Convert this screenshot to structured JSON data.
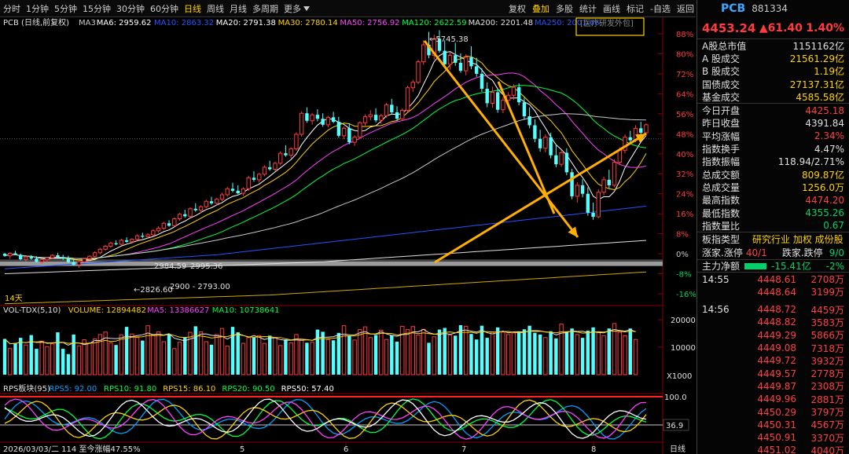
{
  "toolbar": {
    "left_items": [
      "分时",
      "1分钟",
      "5分钟",
      "15分钟",
      "30分钟",
      "60分钟",
      "日线",
      "周线",
      "月线",
      "多周期",
      "更多"
    ],
    "active": "日线",
    "right_items": [
      "复权",
      "叠加",
      "多股",
      "统计",
      "画线",
      "标记",
      "-自选",
      "返回"
    ],
    "highlight": "叠加"
  },
  "main_legend": {
    "title": "PCB (日线,前复权)",
    "items": [
      {
        "label": "MA3",
        "color": "#c8c8c8"
      },
      {
        "label": "MA6: 2959.62",
        "color": "#ffffff"
      },
      {
        "label": "MA10: 2863.32",
        "color": "#2255ff"
      },
      {
        "label": "MA20: 2791.38",
        "color": "#ffffff"
      },
      {
        "label": "MA30: 2780.14",
        "color": "#ffd200"
      },
      {
        "label": "MA50: 2756.92",
        "color": "#ff40ff"
      },
      {
        "label": "MA120: 2622.59",
        "color": "#00ff40"
      },
      {
        "label": "MA200: 2201.48",
        "color": "#e0e0e0"
      },
      {
        "label": "MA250: 2001.66",
        "color": "#2255ff"
      }
    ],
    "badge": "[医疗研发外包]",
    "badge_color": "#ffd200"
  },
  "volume_legend": {
    "items": [
      {
        "label": "VOL-TDX(5,10)",
        "color": "#e0e0e0"
      },
      {
        "label": "VOLUME: 12894482",
        "color": "#ffd200"
      },
      {
        "label": "MA5: 13386627",
        "color": "#ff40ff"
      },
      {
        "label": "MA10: 10738641",
        "color": "#00ff40"
      }
    ]
  },
  "rps_legend": {
    "items": [
      {
        "label": "RPS板块(95)",
        "color": "#e0e0e0"
      },
      {
        "label": "RPS5: 92.00",
        "color": "#00a0ff"
      },
      {
        "label": "RPS10: 91.80",
        "color": "#00ff40"
      },
      {
        "label": "RPS15: 86.10",
        "color": "#ffd200"
      },
      {
        "label": "RPS20: 90.50",
        "color": "#00ff40"
      },
      {
        "label": "RPS50: 57.40",
        "color": "#ffffff"
      }
    ]
  },
  "annotations": {
    "high_label": "5745.38",
    "low_label": "2826.60",
    "label_a": "2984.59",
    "label_b": "2995.36",
    "label_c": "2900 - 2793.00",
    "days_label": "14天",
    "scale_label": "X1000",
    "rps_current": "36.9",
    "bottom_info": "2026/03/03/二 114 至今涨幅47.55%",
    "period_label": "日线"
  },
  "chart_data": {
    "type": "candlestick",
    "x_month_labels": [
      "5",
      "6",
      "7",
      "8"
    ],
    "y_pct_ticks": [
      "88%",
      "80%",
      "72%",
      "64%",
      "56%",
      "48%",
      "40%",
      "32%",
      "24%",
      "16%",
      "8%",
      "0%",
      "-8%",
      "-16%"
    ],
    "volume_ticks": [
      "20000",
      "10000"
    ],
    "rps_ticks": [
      "100.0"
    ],
    "candles": [
      [
        0.0,
        0.4,
        -1.2,
        -0.8
      ],
      [
        -0.8,
        0.6,
        -2.0,
        0.2
      ],
      [
        0.2,
        1.2,
        -0.5,
        -0.4
      ],
      [
        -0.4,
        0.1,
        -2.6,
        -2.2
      ],
      [
        -2.2,
        -0.9,
        -3.0,
        -1.3
      ],
      [
        -1.3,
        -0.5,
        -2.4,
        -1.9
      ],
      [
        -1.9,
        -1.0,
        -3.6,
        -3.2
      ],
      [
        -3.2,
        -1.8,
        -4.0,
        -2.4
      ],
      [
        -2.4,
        -1.2,
        -3.4,
        -1.6
      ],
      [
        -1.6,
        -0.2,
        -2.2,
        -0.6
      ],
      [
        -0.6,
        0.4,
        -1.8,
        -1.4
      ],
      [
        -1.4,
        -0.4,
        -2.6,
        -2.0
      ],
      [
        -2.0,
        -0.8,
        -3.8,
        -3.4
      ],
      [
        -3.4,
        -2.2,
        -4.8,
        -4.4
      ],
      [
        -4.4,
        -2.8,
        -5.6,
        -3.2
      ],
      [
        -3.2,
        -1.6,
        -3.8,
        -2.0
      ],
      [
        -2.0,
        -0.6,
        -2.6,
        -1.0
      ],
      [
        -1.0,
        1.0,
        -1.4,
        0.4
      ],
      [
        0.4,
        2.4,
        -0.2,
        1.8
      ],
      [
        1.8,
        3.6,
        1.2,
        3.0
      ],
      [
        3.0,
        4.8,
        2.4,
        4.2
      ],
      [
        4.2,
        5.4,
        3.4,
        3.8
      ],
      [
        3.8,
        6.0,
        3.2,
        5.4
      ],
      [
        5.4,
        6.6,
        4.4,
        4.8
      ],
      [
        4.8,
        6.2,
        4.0,
        5.8
      ],
      [
        5.8,
        7.8,
        5.2,
        7.2
      ],
      [
        7.2,
        8.4,
        6.2,
        6.8
      ],
      [
        6.8,
        8.2,
        6.0,
        7.6
      ],
      [
        7.6,
        9.8,
        7.0,
        9.2
      ],
      [
        9.2,
        11.0,
        8.4,
        10.2
      ],
      [
        10.2,
        12.8,
        9.6,
        12.2
      ],
      [
        12.2,
        13.4,
        10.8,
        11.2
      ],
      [
        11.2,
        14.6,
        10.6,
        14.0
      ],
      [
        14.0,
        16.4,
        13.2,
        15.8
      ],
      [
        15.8,
        17.6,
        14.4,
        15.0
      ],
      [
        15.0,
        18.6,
        14.4,
        18.0
      ],
      [
        18.0,
        20.2,
        16.8,
        17.4
      ],
      [
        17.4,
        19.4,
        16.2,
        18.8
      ],
      [
        18.8,
        21.6,
        18.2,
        21.0
      ],
      [
        21.0,
        22.8,
        19.6,
        20.2
      ],
      [
        20.2,
        22.4,
        19.4,
        21.8
      ],
      [
        21.8,
        24.4,
        21.0,
        23.6
      ],
      [
        23.6,
        26.8,
        22.8,
        26.0
      ],
      [
        26.0,
        28.4,
        24.6,
        25.2
      ],
      [
        25.2,
        27.4,
        23.8,
        24.2
      ],
      [
        24.2,
        26.6,
        23.2,
        26.0
      ],
      [
        26.0,
        31.2,
        25.2,
        30.4
      ],
      [
        30.4,
        33.0,
        28.8,
        29.6
      ],
      [
        29.6,
        32.4,
        28.4,
        31.8
      ],
      [
        31.8,
        35.4,
        31.0,
        34.6
      ],
      [
        34.6,
        37.2,
        33.2,
        33.8
      ],
      [
        33.8,
        36.8,
        33.0,
        36.2
      ],
      [
        36.2,
        41.0,
        35.4,
        40.2
      ],
      [
        40.2,
        43.4,
        38.8,
        39.4
      ],
      [
        39.4,
        42.6,
        38.2,
        42.0
      ],
      [
        42.0,
        48.6,
        41.2,
        47.8
      ],
      [
        47.8,
        57.0,
        46.8,
        56.2
      ],
      [
        56.2,
        58.6,
        52.4,
        53.2
      ],
      [
        53.2,
        56.4,
        51.6,
        55.6
      ],
      [
        55.6,
        57.8,
        53.0,
        54.0
      ],
      [
        54.0,
        56.2,
        50.8,
        51.6
      ],
      [
        51.6,
        55.2,
        50.6,
        54.6
      ],
      [
        54.6,
        56.8,
        52.2,
        52.8
      ],
      [
        52.8,
        54.8,
        46.4,
        47.2
      ],
      [
        47.2,
        51.0,
        45.8,
        50.2
      ],
      [
        50.2,
        52.2,
        43.8,
        44.6
      ],
      [
        44.6,
        47.4,
        43.2,
        46.6
      ],
      [
        46.6,
        53.0,
        46.0,
        52.4
      ],
      [
        52.4,
        55.8,
        51.2,
        54.8
      ],
      [
        54.8,
        57.4,
        53.4,
        55.6
      ],
      [
        55.6,
        58.2,
        52.6,
        53.4
      ],
      [
        53.4,
        56.0,
        52.0,
        55.2
      ],
      [
        55.2,
        60.4,
        54.4,
        59.6
      ],
      [
        59.6,
        62.0,
        55.8,
        56.6
      ],
      [
        56.6,
        59.0,
        53.2,
        54.0
      ],
      [
        54.0,
        58.2,
        53.2,
        57.4
      ],
      [
        57.4,
        67.2,
        56.6,
        66.4
      ],
      [
        66.4,
        69.6,
        64.8,
        68.6
      ],
      [
        68.6,
        77.6,
        67.8,
        76.8
      ],
      [
        76.8,
        85.4,
        75.6,
        83.6
      ],
      [
        83.6,
        88.8,
        78.2,
        79.4
      ],
      [
        79.4,
        87.6,
        77.6,
        86.0
      ],
      [
        86.0,
        89.4,
        80.4,
        81.2
      ],
      [
        81.2,
        85.4,
        74.6,
        75.8
      ],
      [
        75.8,
        80.6,
        73.6,
        79.4
      ],
      [
        79.4,
        84.4,
        75.2,
        76.4
      ],
      [
        76.4,
        80.2,
        72.4,
        73.2
      ],
      [
        73.2,
        79.8,
        71.4,
        78.6
      ],
      [
        78.6,
        83.0,
        73.8,
        75.0
      ],
      [
        75.0,
        78.4,
        70.8,
        72.0
      ],
      [
        72.0,
        74.2,
        64.8,
        66.0
      ],
      [
        66.0,
        68.6,
        58.6,
        60.2
      ],
      [
        60.2,
        66.8,
        58.4,
        64.6
      ],
      [
        64.6,
        65.8,
        56.4,
        57.6
      ],
      [
        57.6,
        62.8,
        56.2,
        61.4
      ],
      [
        61.4,
        64.6,
        59.2,
        63.4
      ],
      [
        63.4,
        67.8,
        61.6,
        66.6
      ],
      [
        66.6,
        68.2,
        59.4,
        60.6
      ],
      [
        60.6,
        62.4,
        53.6,
        55.0
      ],
      [
        55.0,
        58.6,
        50.2,
        51.4
      ],
      [
        51.4,
        53.8,
        44.6,
        46.0
      ],
      [
        46.0,
        49.6,
        40.8,
        42.2
      ],
      [
        42.2,
        47.8,
        40.6,
        46.6
      ],
      [
        46.6,
        48.4,
        38.2,
        39.4
      ],
      [
        39.4,
        43.8,
        34.6,
        35.8
      ],
      [
        35.8,
        41.6,
        34.8,
        40.4
      ],
      [
        40.4,
        42.2,
        31.4,
        32.6
      ],
      [
        32.6,
        34.0,
        21.8,
        23.0
      ],
      [
        23.0,
        28.6,
        20.4,
        27.4
      ],
      [
        27.4,
        29.8,
        22.6,
        24.0
      ],
      [
        24.0,
        26.6,
        15.2,
        16.4
      ],
      [
        16.4,
        20.4,
        13.6,
        14.8
      ],
      [
        14.8,
        25.8,
        14.2,
        24.6
      ],
      [
        24.6,
        30.8,
        23.4,
        29.6
      ],
      [
        29.6,
        33.6,
        26.2,
        27.4
      ],
      [
        27.4,
        37.8,
        26.6,
        36.6
      ],
      [
        36.6,
        42.6,
        35.4,
        41.4
      ],
      [
        41.4,
        47.8,
        40.2,
        46.6
      ],
      [
        46.6,
        49.2,
        44.2,
        45.4
      ],
      [
        45.4,
        51.4,
        44.6,
        50.2
      ],
      [
        50.2,
        52.8,
        47.6,
        48.4
      ],
      [
        48.4,
        52.2,
        47.2,
        51.6
      ]
    ],
    "volume": [
      13.0,
      9.5,
      11.5,
      13.4,
      10.8,
      14.4,
      9.4,
      12.2,
      10.2,
      11.2,
      15.4,
      9.4,
      7.5,
      14.6,
      10.5,
      12.7,
      11.4,
      13.0,
      14.6,
      15.5,
      11.6,
      10.8,
      14.5,
      17.4,
      14.8,
      13.5,
      12.4,
      17.8,
      14.4,
      15.6,
      12.0,
      14.8,
      9.5,
      11.8,
      13.5,
      15.4,
      17.6,
      15.6,
      12.0,
      10.9,
      14.6,
      16.8,
      10.4,
      17.4,
      15.4,
      11.4,
      13.5,
      13.5,
      14.2,
      11.4,
      14.2,
      13.5,
      10.6,
      12.8,
      11.6,
      14.6,
      12.8,
      11.6,
      11.8,
      16.4,
      15.6,
      12.8,
      12.5,
      15.2,
      17.8,
      14.2,
      12.6,
      16.4,
      17.4,
      13.5,
      14.4,
      16.2,
      12.8,
      14.4,
      12.0,
      17.6,
      16.4,
      17.5,
      14.4,
      16.5,
      11.6,
      13.8,
      16.4,
      17.0,
      14.5,
      14.2,
      18.0,
      17.6,
      14.8,
      12.8,
      17.8,
      13.4,
      15.4,
      17.2,
      15.5,
      14.6,
      15.2,
      15.6,
      16.5,
      17.8,
      15.2,
      14.6,
      13.5,
      15.8,
      13.2,
      18.4,
      15.6,
      16.8,
      14.6,
      13.4,
      16.0,
      17.2,
      15.4,
      14.2,
      16.8,
      18.6,
      15.4,
      14.2,
      16.8,
      12.8
    ]
  },
  "right_panel": {
    "name": "PCB",
    "code": "881334",
    "price": "4453.24",
    "change": "▲61.40",
    "change_pct": "1.40%",
    "stats": [
      {
        "k": "A股总市值",
        "v": "1151162亿",
        "c": ""
      },
      {
        "k": " A 股成交",
        "v": "21561.29亿",
        "c": "yellow"
      },
      {
        "k": " B 股成交",
        "v": "1.19亿",
        "c": "yellow"
      },
      {
        "k": "国债成交",
        "v": "27137.31亿",
        "c": "yellow"
      },
      {
        "k": "基金成交",
        "v": "4585.58亿",
        "c": "yellow"
      }
    ],
    "stats2": [
      {
        "k": "今日开盘",
        "v": "4425.18",
        "c": "red"
      },
      {
        "k": "昨日收盘",
        "v": "4391.84",
        "c": ""
      },
      {
        "k": "平均涨幅",
        "v": "2.34%",
        "c": "red"
      },
      {
        "k": "指数换手",
        "v": "4.47%",
        "c": ""
      },
      {
        "k": "指数振幅",
        "v": "118.94/2.71%",
        "c": ""
      },
      {
        "k": "总成交额",
        "v": "809.87亿",
        "c": "yellow"
      },
      {
        "k": "总成交量",
        "v": "1256.0万",
        "c": "yellow"
      },
      {
        "k": "最高指数",
        "v": "4474.20",
        "c": "red"
      },
      {
        "k": "最低指数",
        "v": "4355.26",
        "c": "green"
      },
      {
        "k": "指数量比",
        "v": "0.67",
        "c": "green"
      }
    ],
    "board_type": {
      "k": "板指类型",
      "v": "研究行业 加权 成份股"
    },
    "limits": {
      "k1": "涨家.涨停",
      "v1": "40/1",
      "k2": "跌家.跌停",
      "v2": "9/0"
    },
    "flow": {
      "k": "主力净额",
      "v": "-15.41亿",
      "pct": "-2%"
    },
    "ticks": [
      {
        "t": "14:55",
        "p": "4448.61",
        "v": "2708万"
      },
      {
        "t": "",
        "p": "4448.64",
        "v": "3199万"
      },
      {
        "t": "14:56",
        "p": "4448.72",
        "v": "4459万"
      },
      {
        "t": "",
        "p": "4448.82",
        "v": "3583万"
      },
      {
        "t": "",
        "p": "4449.29",
        "v": "5866万"
      },
      {
        "t": "",
        "p": "4449.08",
        "v": "7318万"
      },
      {
        "t": "",
        "p": "4449.72",
        "v": "3932万"
      },
      {
        "t": "",
        "p": "4449.57",
        "v": "2778万"
      },
      {
        "t": "",
        "p": "4449.87",
        "v": "2308万"
      },
      {
        "t": "",
        "p": "4449.96",
        "v": "2881万"
      },
      {
        "t": "",
        "p": "4450.29",
        "v": "3797万"
      },
      {
        "t": "",
        "p": "4450.31",
        "v": "4567万"
      },
      {
        "t": "",
        "p": "4450.91",
        "v": "3370万"
      },
      {
        "t": "",
        "p": "4451.02",
        "v": "4040万"
      },
      {
        "t": "",
        "p": "4450.91",
        "v": "3781万"
      }
    ]
  }
}
